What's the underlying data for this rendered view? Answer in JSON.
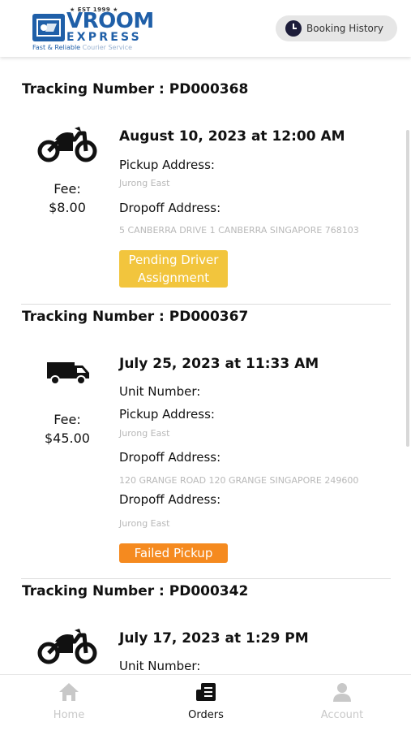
{
  "header": {
    "logo": {
      "est": "★ EST 1999 ★",
      "brand": "VROOM",
      "sub": "EXPRESS",
      "tagline_main": "Fast & Reliable",
      "tagline_dim": "Courier Service"
    },
    "booking_history_label": "Booking History"
  },
  "orders": [
    {
      "tracking_label": "Tracking Number : PD000368",
      "vehicle_icon": "motorcycle-icon",
      "fee_label": "Fee:",
      "fee_value": "$8.00",
      "datetime": "August 10, 2023 at 12:00 AM",
      "pickup_label": "Pickup Address:",
      "pickup_value": "Jurong East",
      "dropoff_label": "Dropoff Address:",
      "dropoff_value": "5 CANBERRA DRIVE 1 CANBERRA SINGAPORE 768103",
      "status": "Pending Driver Assignment",
      "status_color": "#f2c53d"
    },
    {
      "tracking_label": "Tracking Number : PD000367",
      "vehicle_icon": "van-icon",
      "fee_label": "Fee:",
      "fee_value": "$45.00",
      "datetime": "July 25, 2023 at 11:33 AM",
      "unit_label": "Unit Number:",
      "pickup_label": "Pickup Address:",
      "pickup_value": "Jurong East",
      "dropoff_label": "Dropoff Address:",
      "dropoff_value": "120 GRANGE ROAD 120 GRANGE SINGAPORE 249600",
      "dropoff2_label": "Dropoff Address:",
      "dropoff2_value": "Jurong East",
      "status": "Failed Pickup",
      "status_color": "#f58a1f"
    },
    {
      "tracking_label": "Tracking Number : PD000342",
      "vehicle_icon": "motorcycle-icon",
      "datetime": "July 17, 2023 at 1:29 PM",
      "unit_label": "Unit Number:"
    }
  ],
  "bottom_nav": {
    "items": [
      {
        "label": "Home",
        "icon": "home-icon",
        "active": false
      },
      {
        "label": "Orders",
        "icon": "orders-icon",
        "active": true
      },
      {
        "label": "Account",
        "icon": "account-icon",
        "active": false
      }
    ]
  },
  "colors": {
    "brand": "#1f5fa8",
    "pending": "#f2c53d",
    "failed": "#f58a1f",
    "muted_text": "#b8b8b8"
  }
}
